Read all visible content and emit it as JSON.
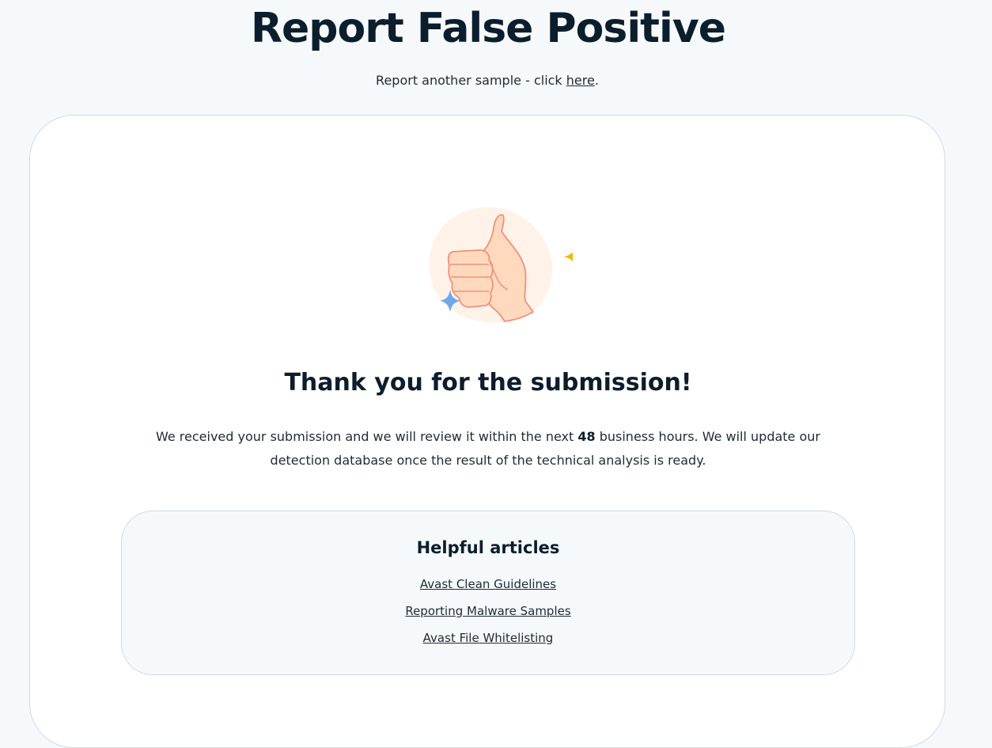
{
  "header": {
    "title": "Report False Positive",
    "subline_prefix": "Report another sample - click ",
    "subline_link": "here",
    "subline_suffix": "."
  },
  "card": {
    "illustration": "thumbs-up-icon",
    "heading": "Thank you for the submission!",
    "message_part1": "We received your submission and we will review it within the next ",
    "message_hours": "48",
    "message_part2": " business hours. We will update our detection database once the result of the technical analysis is ready."
  },
  "articles": {
    "heading": "Helpful articles",
    "links": [
      "Avast Clean Guidelines",
      "Reporting Malware Samples",
      "Avast File Whitelisting"
    ]
  },
  "colors": {
    "background": "#f6f9fc",
    "text": "#0c1d2c",
    "border": "#cfdbe6",
    "sparkle_yellow": "#f6b400",
    "sparkle_blue": "#6ea7ec"
  }
}
